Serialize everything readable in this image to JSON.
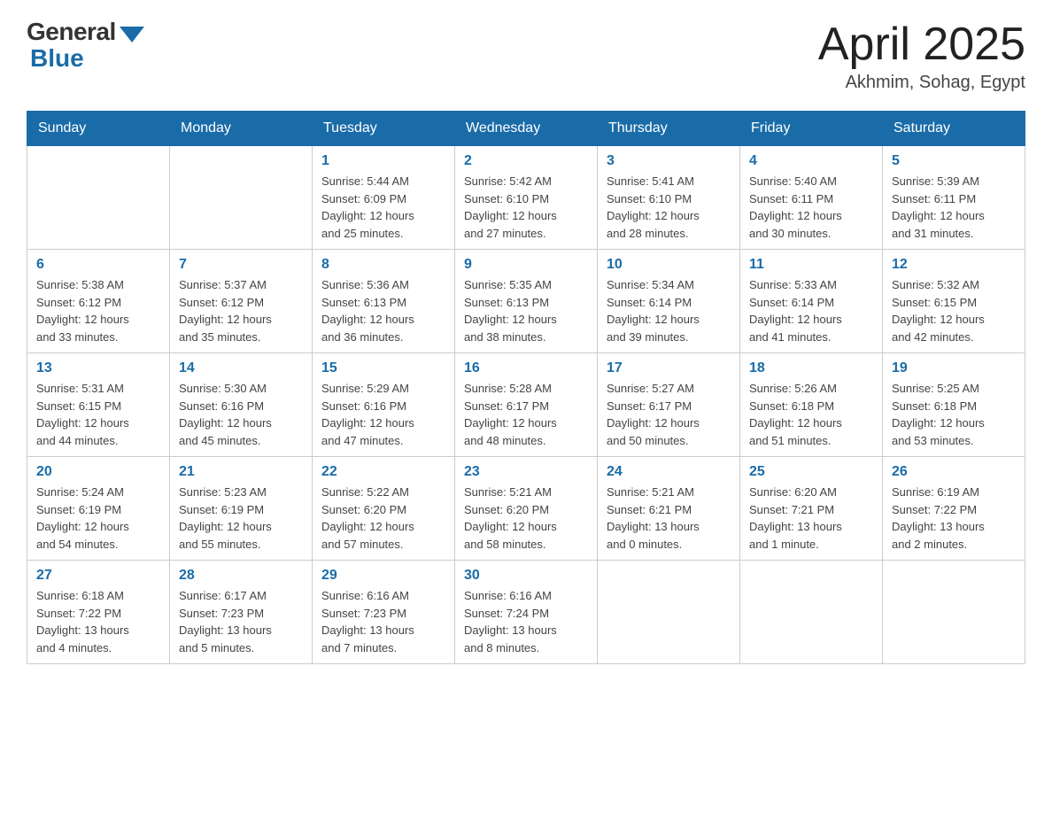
{
  "header": {
    "logo_general": "General",
    "logo_blue": "Blue",
    "month_title": "April 2025",
    "location": "Akhmim, Sohag, Egypt"
  },
  "weekdays": [
    "Sunday",
    "Monday",
    "Tuesday",
    "Wednesday",
    "Thursday",
    "Friday",
    "Saturday"
  ],
  "weeks": [
    [
      {
        "day": "",
        "info": ""
      },
      {
        "day": "",
        "info": ""
      },
      {
        "day": "1",
        "info": "Sunrise: 5:44 AM\nSunset: 6:09 PM\nDaylight: 12 hours\nand 25 minutes."
      },
      {
        "day": "2",
        "info": "Sunrise: 5:42 AM\nSunset: 6:10 PM\nDaylight: 12 hours\nand 27 minutes."
      },
      {
        "day": "3",
        "info": "Sunrise: 5:41 AM\nSunset: 6:10 PM\nDaylight: 12 hours\nand 28 minutes."
      },
      {
        "day": "4",
        "info": "Sunrise: 5:40 AM\nSunset: 6:11 PM\nDaylight: 12 hours\nand 30 minutes."
      },
      {
        "day": "5",
        "info": "Sunrise: 5:39 AM\nSunset: 6:11 PM\nDaylight: 12 hours\nand 31 minutes."
      }
    ],
    [
      {
        "day": "6",
        "info": "Sunrise: 5:38 AM\nSunset: 6:12 PM\nDaylight: 12 hours\nand 33 minutes."
      },
      {
        "day": "7",
        "info": "Sunrise: 5:37 AM\nSunset: 6:12 PM\nDaylight: 12 hours\nand 35 minutes."
      },
      {
        "day": "8",
        "info": "Sunrise: 5:36 AM\nSunset: 6:13 PM\nDaylight: 12 hours\nand 36 minutes."
      },
      {
        "day": "9",
        "info": "Sunrise: 5:35 AM\nSunset: 6:13 PM\nDaylight: 12 hours\nand 38 minutes."
      },
      {
        "day": "10",
        "info": "Sunrise: 5:34 AM\nSunset: 6:14 PM\nDaylight: 12 hours\nand 39 minutes."
      },
      {
        "day": "11",
        "info": "Sunrise: 5:33 AM\nSunset: 6:14 PM\nDaylight: 12 hours\nand 41 minutes."
      },
      {
        "day": "12",
        "info": "Sunrise: 5:32 AM\nSunset: 6:15 PM\nDaylight: 12 hours\nand 42 minutes."
      }
    ],
    [
      {
        "day": "13",
        "info": "Sunrise: 5:31 AM\nSunset: 6:15 PM\nDaylight: 12 hours\nand 44 minutes."
      },
      {
        "day": "14",
        "info": "Sunrise: 5:30 AM\nSunset: 6:16 PM\nDaylight: 12 hours\nand 45 minutes."
      },
      {
        "day": "15",
        "info": "Sunrise: 5:29 AM\nSunset: 6:16 PM\nDaylight: 12 hours\nand 47 minutes."
      },
      {
        "day": "16",
        "info": "Sunrise: 5:28 AM\nSunset: 6:17 PM\nDaylight: 12 hours\nand 48 minutes."
      },
      {
        "day": "17",
        "info": "Sunrise: 5:27 AM\nSunset: 6:17 PM\nDaylight: 12 hours\nand 50 minutes."
      },
      {
        "day": "18",
        "info": "Sunrise: 5:26 AM\nSunset: 6:18 PM\nDaylight: 12 hours\nand 51 minutes."
      },
      {
        "day": "19",
        "info": "Sunrise: 5:25 AM\nSunset: 6:18 PM\nDaylight: 12 hours\nand 53 minutes."
      }
    ],
    [
      {
        "day": "20",
        "info": "Sunrise: 5:24 AM\nSunset: 6:19 PM\nDaylight: 12 hours\nand 54 minutes."
      },
      {
        "day": "21",
        "info": "Sunrise: 5:23 AM\nSunset: 6:19 PM\nDaylight: 12 hours\nand 55 minutes."
      },
      {
        "day": "22",
        "info": "Sunrise: 5:22 AM\nSunset: 6:20 PM\nDaylight: 12 hours\nand 57 minutes."
      },
      {
        "day": "23",
        "info": "Sunrise: 5:21 AM\nSunset: 6:20 PM\nDaylight: 12 hours\nand 58 minutes."
      },
      {
        "day": "24",
        "info": "Sunrise: 5:21 AM\nSunset: 6:21 PM\nDaylight: 13 hours\nand 0 minutes."
      },
      {
        "day": "25",
        "info": "Sunrise: 6:20 AM\nSunset: 7:21 PM\nDaylight: 13 hours\nand 1 minute."
      },
      {
        "day": "26",
        "info": "Sunrise: 6:19 AM\nSunset: 7:22 PM\nDaylight: 13 hours\nand 2 minutes."
      }
    ],
    [
      {
        "day": "27",
        "info": "Sunrise: 6:18 AM\nSunset: 7:22 PM\nDaylight: 13 hours\nand 4 minutes."
      },
      {
        "day": "28",
        "info": "Sunrise: 6:17 AM\nSunset: 7:23 PM\nDaylight: 13 hours\nand 5 minutes."
      },
      {
        "day": "29",
        "info": "Sunrise: 6:16 AM\nSunset: 7:23 PM\nDaylight: 13 hours\nand 7 minutes."
      },
      {
        "day": "30",
        "info": "Sunrise: 6:16 AM\nSunset: 7:24 PM\nDaylight: 13 hours\nand 8 minutes."
      },
      {
        "day": "",
        "info": ""
      },
      {
        "day": "",
        "info": ""
      },
      {
        "day": "",
        "info": ""
      }
    ]
  ]
}
